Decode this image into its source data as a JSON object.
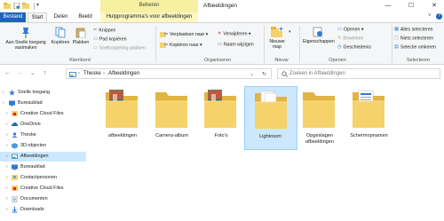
{
  "window": {
    "title": "Afbeeldingen",
    "contextual_group": "Beheren",
    "controls": {
      "minimize": "—",
      "maximize": "☐",
      "close": "✕"
    }
  },
  "tabs": [
    {
      "label": "Bestand",
      "style": "file"
    },
    {
      "label": "Start",
      "style": "active"
    },
    {
      "label": "Delen",
      "style": "normal"
    },
    {
      "label": "Beeld",
      "style": "normal"
    },
    {
      "label": "Hulpprogramma's voor afbeeldingen",
      "style": "contextual"
    }
  ],
  "ribbon": {
    "clipboard": {
      "pin_label": "Aan Snelle toegang\nvastmaken",
      "copy_label": "Kopiëren",
      "paste_label": "Plakken",
      "cut_label": "Knippen",
      "copy_path_label": "Pad kopiëren",
      "paste_shortcut_label": "Snelkoppeling plakken",
      "group_label": "Klembord"
    },
    "organize": {
      "move_label": "Verplaatsen naar",
      "copy_to_label": "Kopiëren naar",
      "delete_label": "Verwijderen",
      "rename_label": "Naam wijzigen",
      "group_label": "Organiseren"
    },
    "new": {
      "new_folder_label": "Nieuwe\nmap",
      "group_label": "Nieuw"
    },
    "open": {
      "properties_label": "Eigenschappen",
      "open_label": "Openen",
      "edit_label": "Bewerken",
      "history_label": "Geschiedenis",
      "group_label": "Openen"
    },
    "select": {
      "select_all_label": "Alles selecteren",
      "select_none_label": "Niets selecteren",
      "invert_label": "Selectie omkeren",
      "group_label": "Selecteren"
    }
  },
  "address": {
    "back": "←",
    "forward": "→",
    "up_history": "⌄",
    "up": "↑",
    "path": [
      "Theske",
      "Afbeeldingen"
    ],
    "separator": "›",
    "dropdown": "⌄",
    "refresh": "↻"
  },
  "search": {
    "placeholder": "Zoeken in Afbeeldingen"
  },
  "navpane": {
    "items": [
      {
        "label": "Snelle toegang",
        "icon": "star-icon",
        "indent": 0
      },
      {
        "label": "Bureaublad",
        "icon": "desktop-icon",
        "indent": 0
      },
      {
        "label": "Creative Cloud Files",
        "icon": "creative-cloud-icon",
        "indent": 1
      },
      {
        "label": "OneDrive",
        "icon": "onedrive-icon",
        "indent": 1
      },
      {
        "label": "Theske",
        "icon": "user-icon",
        "indent": 1
      },
      {
        "label": "3D-objecten",
        "icon": "3d-objects-icon",
        "indent": 1
      },
      {
        "label": "Afbeeldingen",
        "icon": "pictures-folder-icon",
        "indent": 1,
        "selected": true
      },
      {
        "label": "Bureaublad",
        "icon": "desktop-icon",
        "indent": 1
      },
      {
        "label": "Contactpersonen",
        "icon": "contacts-icon",
        "indent": 1
      },
      {
        "label": "Creative Cloud Files",
        "icon": "creative-cloud-icon",
        "indent": 1
      },
      {
        "label": "Documenten",
        "icon": "documents-icon",
        "indent": 1
      },
      {
        "label": "Downloads",
        "icon": "downloads-icon",
        "indent": 1
      }
    ]
  },
  "folders": [
    {
      "name": "afbeeldingen",
      "thumb": "photos"
    },
    {
      "name": "Camera-album",
      "thumb": "empty"
    },
    {
      "name": "Foto's",
      "thumb": "photos"
    },
    {
      "name": "Lightroom",
      "thumb": "papers",
      "selected": true
    },
    {
      "name": "Opgeslagen afbeeldingen",
      "thumb": "empty"
    },
    {
      "name": "Schermopnamen",
      "thumb": "screens"
    }
  ],
  "colors": {
    "accent": "#1d64b8",
    "folder": "#f6d26a",
    "folder_dark": "#e2b441",
    "selection": "#cce8ff",
    "contextual": "#f7efa1"
  }
}
